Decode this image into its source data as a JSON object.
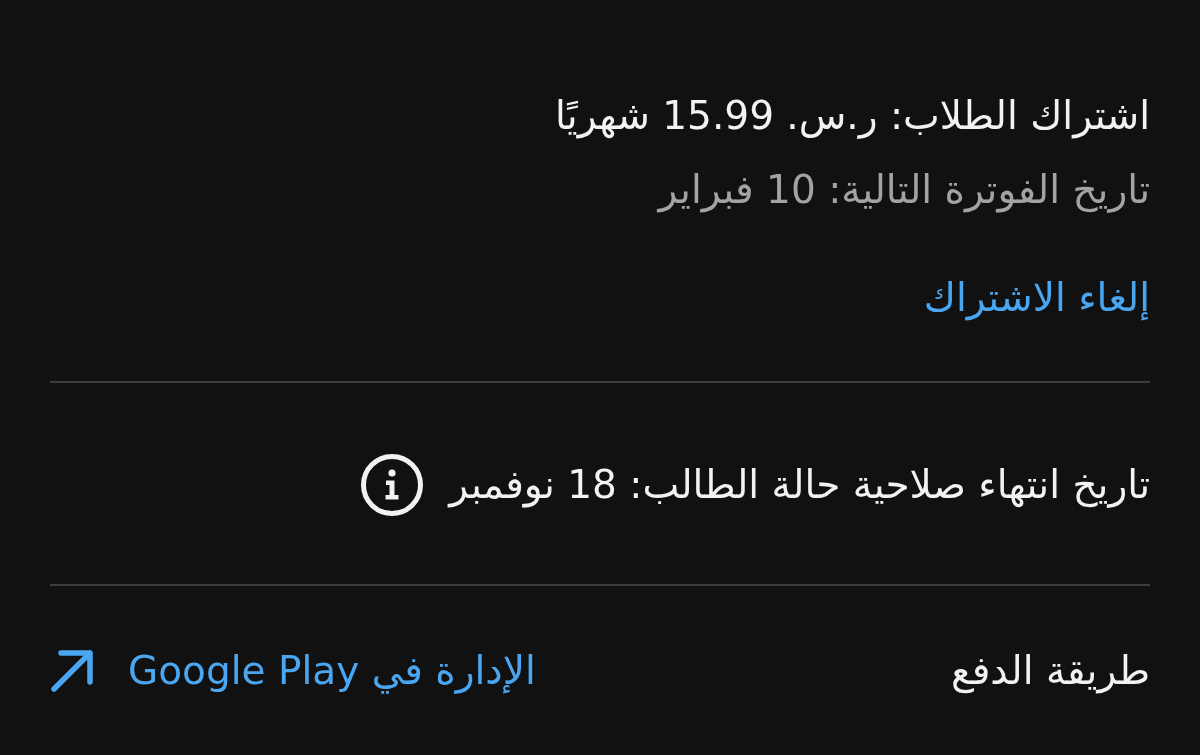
{
  "subscription": {
    "plan": "اشتراك الطلاب: ر.س. 15.99 شهريًا",
    "next_billing": "تاريخ الفوترة التالية: 10 فبراير",
    "cancel_link": "إلغاء الاشتراك"
  },
  "student_status": {
    "expiry": "تاريخ انتهاء صلاحية حالة الطالب: 18 نوفمبر"
  },
  "payment": {
    "label": "طريقة الدفع",
    "manage_link": "الإدارة في Google Play"
  }
}
